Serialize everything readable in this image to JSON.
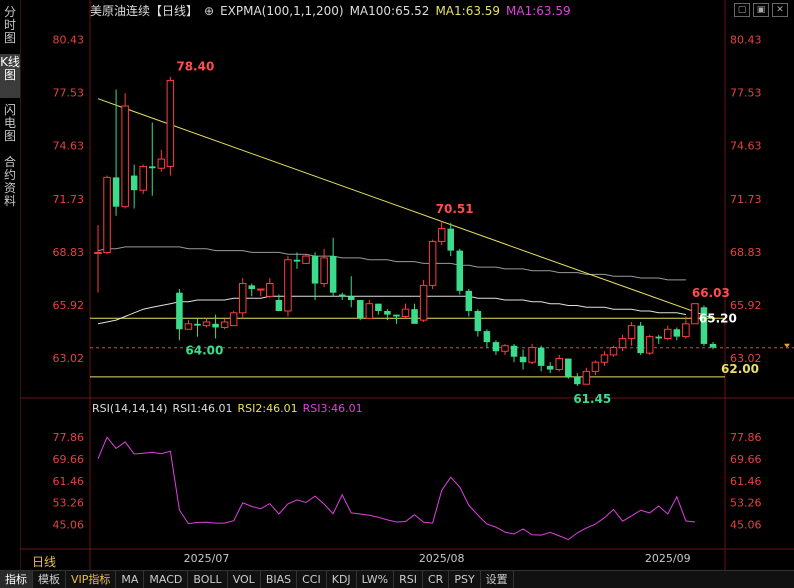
{
  "sidebar": {
    "items": [
      {
        "label": "分时图",
        "active": false
      },
      {
        "label": "K线图",
        "active": true
      },
      {
        "label": "闪电图",
        "active": false
      },
      {
        "label": "合约资料",
        "active": false
      }
    ]
  },
  "header": {
    "title": "美原油连续【日线】",
    "indicator": "EXPMA(100,1,1,200)",
    "ma100": "MA100:65.52",
    "ma1a": "MA1:63.59",
    "ma1b": "MA1:63.59"
  },
  "rsi_header": {
    "name": "RSI(14,14,14)",
    "rsi1": "RSI1:46.01",
    "rsi2": "RSI2:46.01",
    "rsi3": "RSI3:46.01"
  },
  "period_label": "日线",
  "bottom_tabs": [
    "指标",
    "模板",
    "VIP指标",
    "MA",
    "MACD",
    "BOLL",
    "VOL",
    "BIAS",
    "CCI",
    "KDJ",
    "LW%",
    "RSI",
    "CR",
    "PSY",
    "设置"
  ],
  "colors": {
    "up": "#ff3c3c",
    "down": "#3cdc8c",
    "grid": "#6a1414",
    "axis": "#e84040",
    "trend": "#e8e060",
    "ma": "#c8c8c8",
    "rsi": "#e040e0"
  },
  "chart_data": {
    "type": "candlestick",
    "price_axis": {
      "ticks": [
        "80.43",
        "77.53",
        "74.63",
        "71.73",
        "68.83",
        "65.92",
        "63.02"
      ],
      "range": [
        60.9,
        81.5
      ]
    },
    "rsi_axis": {
      "ticks": [
        "77.86",
        "69.66",
        "61.46",
        "53.26",
        "45.06"
      ],
      "range": [
        37.0,
        85.0
      ]
    },
    "x_labels": [
      "2025/07",
      "2025/08",
      "2025/09"
    ],
    "x_label_index": [
      12,
      38,
      63
    ],
    "annotations": [
      {
        "text": "78.40",
        "index": 8,
        "value": 78.4
      },
      {
        "text": "64.00",
        "index": 9,
        "value": 64.0
      },
      {
        "text": "70.51",
        "index": 38,
        "value": 70.51
      },
      {
        "text": "61.45",
        "index": 53,
        "value": 61.45
      },
      {
        "text": "66.03",
        "index": 65,
        "value": 66.03
      },
      {
        "text": "65.20",
        "index": 66,
        "value": 65.2
      },
      {
        "text": "62.00",
        "index": 68,
        "value": 62.0
      }
    ],
    "levels": [
      65.2,
      62.0
    ],
    "current_price": 63.59,
    "trendline": [
      [
        0,
        77.2
      ],
      [
        68,
        65.2
      ]
    ],
    "ma_long": [
      68.9,
      69.0,
      69.0,
      69.1,
      69.1,
      69.1,
      69.1,
      69.1,
      69.1,
      69.1,
      69.0,
      69.0,
      69.0,
      68.9,
      68.9,
      68.9,
      68.9,
      68.8,
      68.8,
      68.8,
      68.8,
      68.7,
      68.7,
      68.7,
      68.6,
      68.6,
      68.6,
      68.5,
      68.5,
      68.5,
      68.4,
      68.4,
      68.4,
      68.3,
      68.3,
      68.3,
      68.2,
      68.2,
      68.2,
      68.2,
      68.1,
      68.1,
      68.0,
      68.0,
      68.0,
      67.9,
      67.9,
      67.9,
      67.8,
      67.8,
      67.8,
      67.7,
      67.7,
      67.7,
      67.6,
      67.6,
      67.6,
      67.5,
      67.5,
      67.5,
      67.4,
      67.4,
      67.4,
      67.3,
      67.3,
      67.3
    ],
    "ma_short": [
      64.9,
      65.0,
      65.1,
      65.3,
      65.5,
      65.7,
      65.8,
      65.9,
      66.0,
      66.1,
      66.1,
      66.2,
      66.2,
      66.2,
      66.2,
      66.3,
      66.3,
      66.3,
      66.3,
      66.4,
      66.4,
      66.4,
      66.4,
      66.4,
      66.4,
      66.4,
      66.4,
      66.4,
      66.4,
      66.4,
      66.4,
      66.4,
      66.4,
      66.4,
      66.4,
      66.4,
      66.4,
      66.4,
      66.4,
      66.4,
      66.4,
      66.4,
      66.3,
      66.3,
      66.3,
      66.2,
      66.2,
      66.2,
      66.1,
      66.1,
      66.0,
      66.0,
      65.9,
      65.9,
      65.8,
      65.8,
      65.8,
      65.7,
      65.7,
      65.7,
      65.6,
      65.6,
      65.5,
      65.5,
      65.5,
      65.4
    ],
    "candles": [
      [
        68.8,
        68.8,
        66.6,
        70.3
      ],
      [
        68.8,
        72.9,
        68.7,
        73.0
      ],
      [
        72.9,
        71.3,
        70.8,
        77.7
      ],
      [
        71.3,
        76.8,
        71.2,
        77.5
      ],
      [
        73.0,
        72.2,
        71.2,
        73.6
      ],
      [
        72.2,
        73.5,
        72.0,
        73.6
      ],
      [
        73.5,
        73.4,
        71.9,
        75.9
      ],
      [
        73.4,
        73.9,
        73.2,
        74.4
      ],
      [
        73.5,
        78.2,
        73.0,
        78.4
      ],
      [
        66.6,
        64.6,
        64.0,
        66.8
      ],
      [
        64.6,
        64.9,
        64.8,
        65.1
      ],
      [
        64.9,
        64.8,
        64.2,
        65.2
      ],
      [
        64.8,
        65.0,
        64.7,
        65.2
      ],
      [
        64.9,
        64.7,
        64.1,
        65.4
      ],
      [
        64.7,
        65.0,
        64.6,
        65.2
      ],
      [
        64.8,
        65.5,
        64.8,
        65.6
      ],
      [
        65.5,
        67.1,
        65.2,
        67.4
      ],
      [
        67.0,
        66.8,
        66.4,
        67.1
      ],
      [
        66.8,
        66.8,
        66.4,
        66.8
      ],
      [
        66.4,
        67.1,
        66.3,
        67.4
      ],
      [
        66.2,
        65.6,
        65.6,
        66.5
      ],
      [
        65.6,
        68.4,
        65.3,
        68.6
      ],
      [
        68.4,
        68.3,
        67.9,
        68.8
      ],
      [
        68.2,
        68.6,
        68.2,
        68.7
      ],
      [
        68.6,
        67.1,
        66.2,
        68.8
      ],
      [
        67.1,
        68.5,
        66.9,
        69.0
      ],
      [
        68.6,
        66.6,
        66.4,
        69.6
      ],
      [
        66.5,
        66.4,
        66.2,
        66.6
      ],
      [
        66.4,
        66.2,
        65.8,
        67.5
      ],
      [
        66.2,
        65.2,
        65.1,
        66.2
      ],
      [
        65.2,
        66.0,
        65.4,
        66.2
      ],
      [
        66.0,
        65.6,
        65.4,
        65.8
      ],
      [
        65.6,
        65.4,
        65.1,
        65.7
      ],
      [
        65.4,
        65.3,
        64.9,
        65.4
      ],
      [
        65.3,
        65.7,
        65.2,
        66.0
      ],
      [
        65.7,
        64.9,
        64.9,
        66.0
      ],
      [
        65.1,
        67.0,
        65.0,
        67.3
      ],
      [
        67.0,
        69.4,
        66.8,
        69.5
      ],
      [
        69.4,
        70.1,
        69.2,
        70.5
      ],
      [
        70.1,
        68.9,
        68.6,
        70.4
      ],
      [
        68.9,
        66.7,
        66.5,
        69.0
      ],
      [
        66.7,
        65.6,
        65.3,
        66.8
      ],
      [
        65.6,
        64.5,
        64.2,
        65.7
      ],
      [
        64.5,
        63.9,
        63.6,
        64.6
      ],
      [
        63.9,
        63.4,
        63.2,
        64.0
      ],
      [
        63.4,
        63.7,
        63.2,
        63.8
      ],
      [
        63.7,
        63.1,
        62.8,
        63.8
      ],
      [
        63.1,
        62.8,
        62.4,
        63.5
      ],
      [
        62.8,
        63.6,
        62.7,
        63.8
      ],
      [
        63.6,
        62.6,
        62.3,
        63.7
      ],
      [
        62.6,
        62.4,
        62.2,
        62.8
      ],
      [
        62.4,
        63.0,
        62.3,
        63.2
      ],
      [
        63.0,
        62.0,
        61.9,
        63.0
      ],
      [
        62.0,
        61.6,
        61.5,
        62.2
      ],
      [
        61.6,
        62.3,
        61.6,
        62.5
      ],
      [
        62.3,
        62.8,
        62.1,
        62.9
      ],
      [
        62.8,
        63.2,
        62.6,
        63.4
      ],
      [
        63.2,
        63.6,
        63.1,
        63.7
      ],
      [
        63.6,
        64.1,
        63.4,
        64.3
      ],
      [
        64.1,
        64.8,
        63.7,
        65.0
      ],
      [
        64.8,
        63.3,
        63.2,
        65.0
      ],
      [
        63.3,
        64.2,
        63.2,
        64.3
      ],
      [
        64.2,
        64.1,
        63.8,
        64.3
      ],
      [
        64.1,
        64.6,
        64.0,
        64.8
      ],
      [
        64.6,
        64.2,
        64.0,
        64.7
      ],
      [
        64.2,
        64.9,
        64.1,
        65.3
      ],
      [
        64.9,
        66.0,
        64.9,
        66.0
      ],
      [
        65.8,
        63.8,
        63.7,
        65.9
      ],
      [
        63.8,
        63.6,
        63.5,
        63.9
      ]
    ],
    "rsi": [
      69.7,
      77.8,
      73.6,
      76.0,
      71.5,
      71.8,
      72.1,
      71.6,
      72.5,
      50.5,
      45.4,
      45.8,
      45.9,
      45.6,
      45.6,
      46.5,
      53.2,
      51.8,
      51.0,
      52.9,
      49.0,
      52.8,
      54.3,
      53.3,
      55.7,
      52.7,
      49.1,
      56.2,
      49.4,
      49.0,
      48.5,
      47.8,
      46.8,
      46.0,
      46.2,
      48.7,
      45.9,
      45.6,
      57.8,
      62.8,
      59.1,
      52.3,
      48.6,
      45.2,
      44.1,
      42.2,
      41.5,
      43.4,
      41.2,
      41.1,
      42.1,
      40.8,
      39.4,
      41.9,
      43.8,
      45.2,
      47.6,
      50.7,
      46.3,
      48.3,
      50.4,
      49.4,
      52.0,
      49.0,
      55.5,
      46.4,
      46.0
    ]
  }
}
